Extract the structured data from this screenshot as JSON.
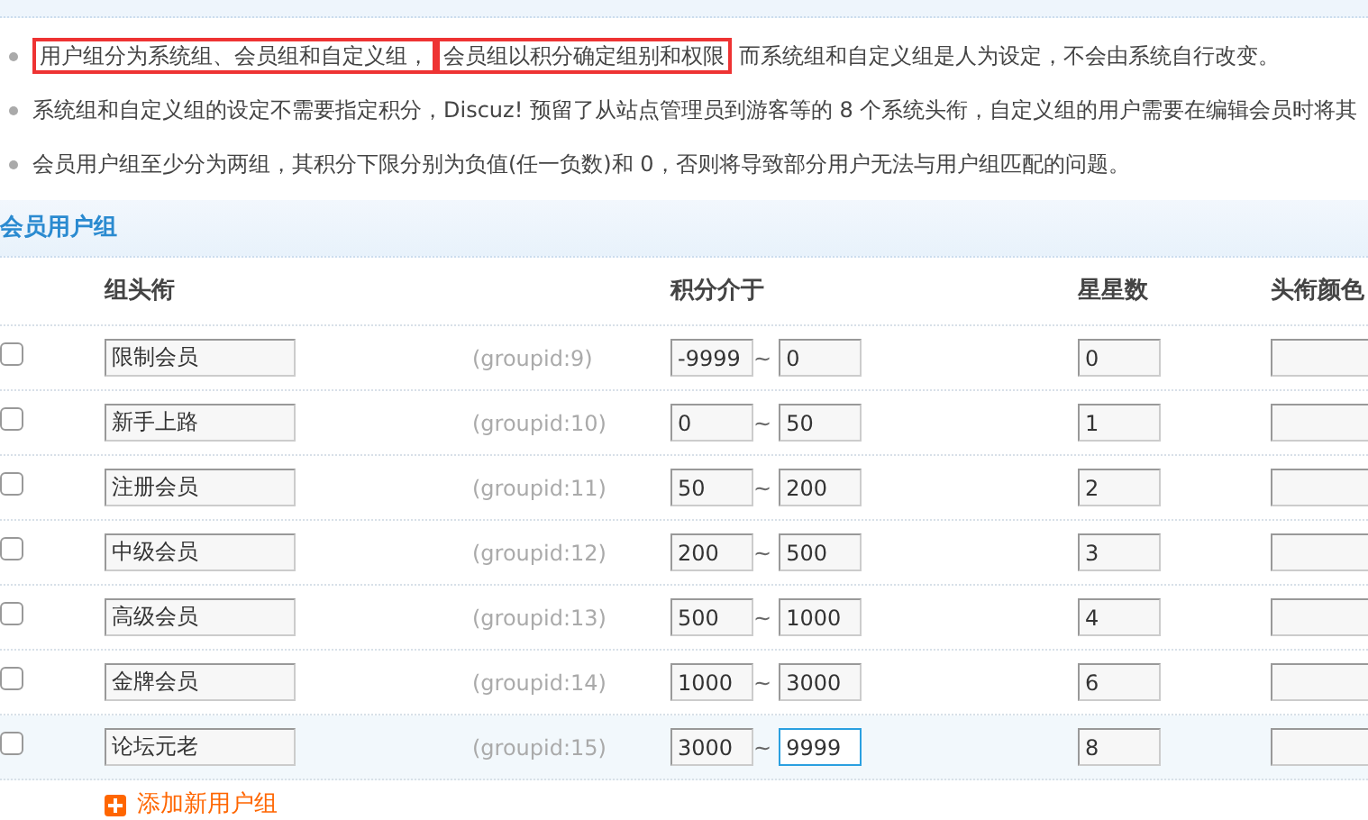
{
  "tips": [
    {
      "parts": [
        {
          "text": "用户组分为系统组、会员组和自定义组，",
          "boxed": true
        },
        {
          "text": "会员组以积分确定组别和权限",
          "boxed": true
        },
        {
          "text": " 而系统组和自定义组是人为设定，不会由系统自行改变。",
          "boxed": false
        }
      ]
    },
    {
      "parts": [
        {
          "text": "系统组和自定义组的设定不需要指定积分，Discuz! 预留了从站点管理员到游客等的 8 个系统头衔，自定义组的用户需要在编辑会员时将其",
          "boxed": false
        }
      ]
    },
    {
      "parts": [
        {
          "text": "会员用户组至少分为两组，其积分下限分别为负值(任一负数)和 0，否则将导致部分用户无法与用户组匹配的问题。",
          "boxed": false
        }
      ]
    }
  ],
  "section_title": "会员用户组",
  "columns": [
    "组头衔",
    "积分介于",
    "星星数",
    "头衔颜色"
  ],
  "rows": [
    {
      "checked": false,
      "highlighted": false,
      "name": "限制会员",
      "groupid": "(groupid:9)",
      "lower": "-9999",
      "separator": "~",
      "upper": "0",
      "stars": "0"
    },
    {
      "checked": false,
      "highlighted": false,
      "name": "新手上路",
      "groupid": "(groupid:10)",
      "lower": "0",
      "separator": "~",
      "upper": "50",
      "stars": "1"
    },
    {
      "checked": false,
      "highlighted": false,
      "name": "注册会员",
      "groupid": "(groupid:11)",
      "lower": "50",
      "separator": "~",
      "upper": "200",
      "stars": "2"
    },
    {
      "checked": false,
      "highlighted": false,
      "name": "中级会员",
      "groupid": "(groupid:12)",
      "lower": "200",
      "separator": "~",
      "upper": "500",
      "stars": "3"
    },
    {
      "checked": false,
      "highlighted": false,
      "name": "高级会员",
      "groupid": "(groupid:13)",
      "lower": "500",
      "separator": "~",
      "upper": "1000",
      "stars": "4"
    },
    {
      "checked": false,
      "highlighted": false,
      "name": "金牌会员",
      "groupid": "(groupid:14)",
      "lower": "1000",
      "separator": "~",
      "upper": "3000",
      "stars": "6"
    },
    {
      "checked": false,
      "highlighted": true,
      "name": "论坛元老",
      "groupid": "(groupid:15)",
      "lower": "3000",
      "separator": "~",
      "upper": "9999",
      "stars": "8"
    }
  ],
  "add_link": "添加新用户组"
}
